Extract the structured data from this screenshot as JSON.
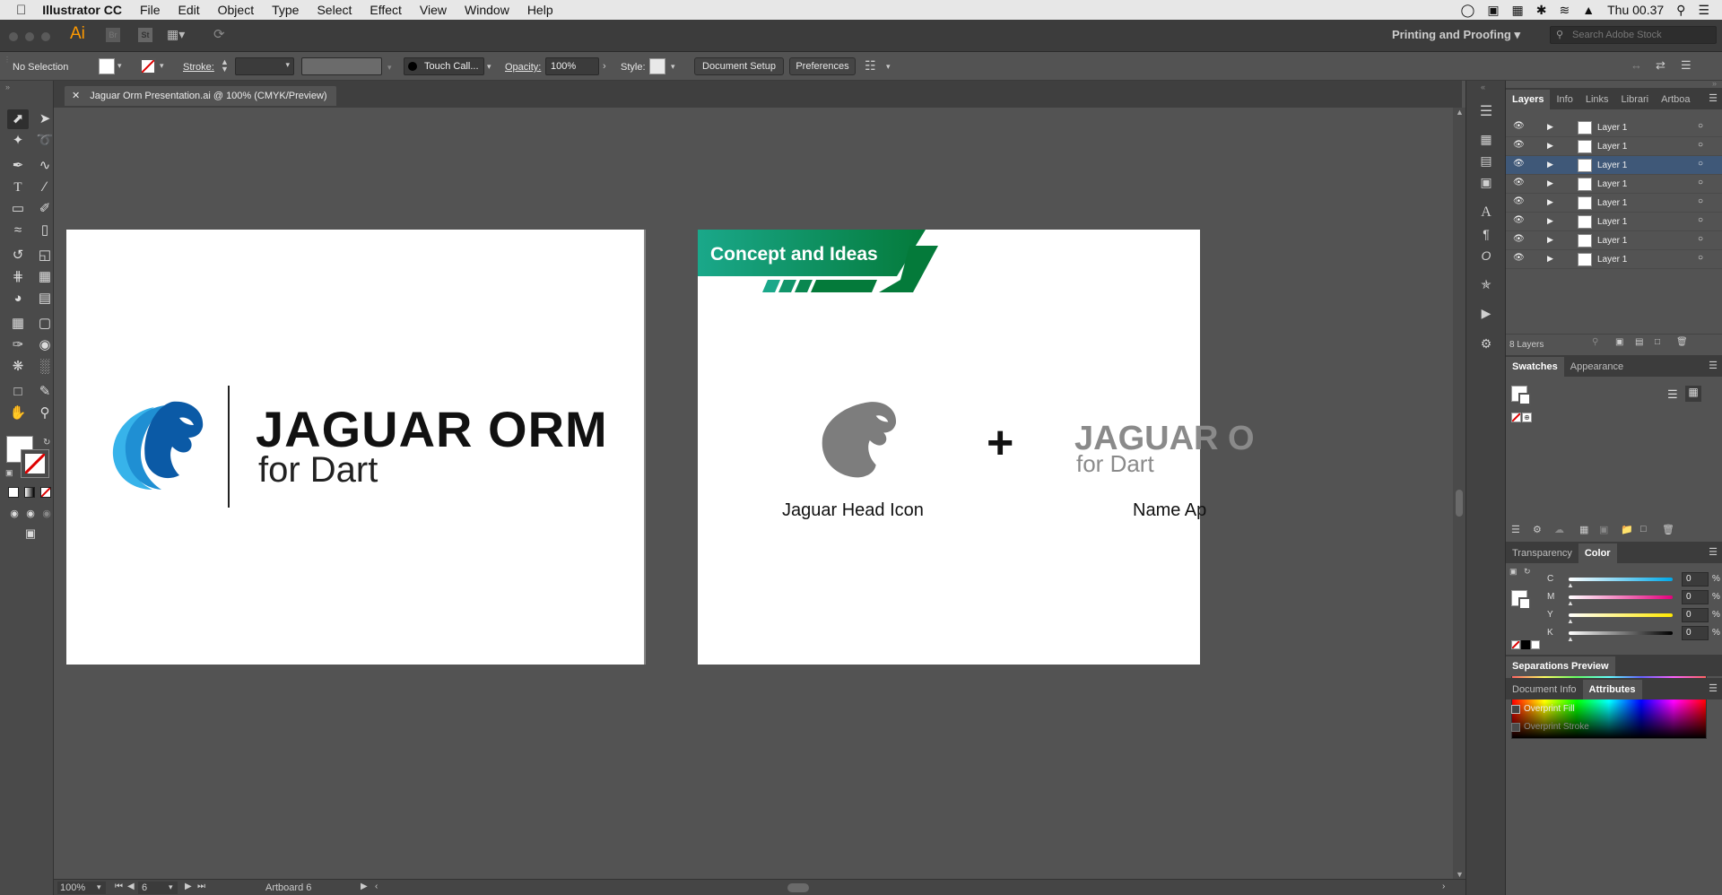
{
  "menubar": {
    "apple_icon": "apple-icon",
    "app_name": "Illustrator CC",
    "items": [
      "File",
      "Edit",
      "Object",
      "Type",
      "Select",
      "Effect",
      "View",
      "Window",
      "Help"
    ],
    "clock": "Thu 00.37"
  },
  "appbar": {
    "logo": "Ai",
    "bridge_label": "Br",
    "stock_label": "St",
    "workspace": "Printing and Proofing",
    "search_placeholder": "Search Adobe Stock"
  },
  "control_bar": {
    "selection_status": "No Selection",
    "stroke_label": "Stroke:",
    "brush_name": "Touch Call...",
    "opacity_label": "Opacity:",
    "opacity_value": "100%",
    "style_label": "Style:",
    "document_setup_button": "Document Setup",
    "preferences_button": "Preferences"
  },
  "document_tab": {
    "close_icon": "close-icon",
    "title": "Jaguar Orm Presentation.ai @ 100% (CMYK/Preview)"
  },
  "artboard_left": {
    "title_line1": "JAGUAR ORM",
    "title_line2": "for Dart",
    "colors": {
      "logo_dark": "#0b5aa6",
      "logo_mid": "#1f8fd3",
      "logo_light": "#37b3ea"
    }
  },
  "artboard_right": {
    "banner_title": "Concept and Ideas",
    "icon_caption": "Jaguar Head Icon",
    "plus_sign": "+",
    "name_title_line1": "JAGUAR O",
    "name_title_line2": "for Dart",
    "name_caption": "Name Ap",
    "colors": {
      "banner_start": "#1aa88a",
      "banner_end": "#047a3a",
      "icon_gray": "#7d7d7d"
    }
  },
  "status_bar": {
    "zoom": "100%",
    "artboard_number": "6",
    "artboard_label": "Artboard 6"
  },
  "layers_panel": {
    "tabs": [
      "Layers",
      "Info",
      "Links",
      "Librari",
      "Artboa"
    ],
    "layers": [
      "Layer 1",
      "Layer 1",
      "Layer 1",
      "Layer 1",
      "Layer 1",
      "Layer 1",
      "Layer 1",
      "Layer 1"
    ],
    "count_label": "8 Layers"
  },
  "swatches_panel": {
    "tabs": [
      "Swatches",
      "Appearance"
    ]
  },
  "color_panel": {
    "tabs": [
      "Transparency",
      "Color"
    ],
    "channels": [
      {
        "name": "C",
        "value": "0",
        "unit": "%"
      },
      {
        "name": "M",
        "value": "0",
        "unit": "%"
      },
      {
        "name": "Y",
        "value": "0",
        "unit": "%"
      },
      {
        "name": "K",
        "value": "0",
        "unit": "%"
      }
    ]
  },
  "separations_panel": {
    "tab": "Separations Preview"
  },
  "attributes_panel": {
    "tabs": [
      "Document Info",
      "Attributes"
    ],
    "overprint_fill": "Overprint Fill",
    "overprint_stroke": "Overprint Stroke"
  }
}
